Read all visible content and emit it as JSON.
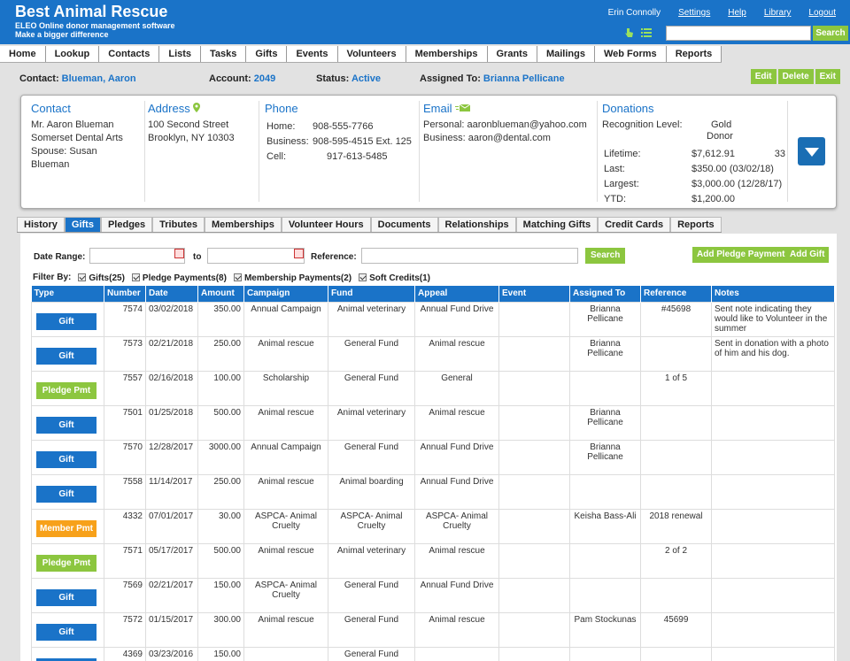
{
  "app": {
    "title": "Best Animal Rescue",
    "tagline1": "ELEO Online donor management software",
    "tagline2": "Make a bigger difference",
    "user": "Erin Connolly",
    "links": [
      "Settings",
      "Help",
      "Library",
      "Logout"
    ],
    "search_label": "Search"
  },
  "nav": [
    "Home",
    "Lookup",
    "Contacts",
    "Lists",
    "Tasks",
    "Gifts",
    "Events",
    "Volunteers",
    "Memberships",
    "Grants",
    "Mailings",
    "Web Forms",
    "Reports"
  ],
  "contact": {
    "contact_label": "Contact:",
    "contact": "Blueman, Aaron",
    "account_label": "Account:",
    "account": "2049",
    "status_label": "Status:",
    "status": "Active",
    "assigned_label": "Assigned To:",
    "assigned": "Brianna Pellicane",
    "buttons": [
      "Edit",
      "Delete",
      "Exit"
    ]
  },
  "card": {
    "contact_title": "Contact",
    "contact_lines": [
      "Mr. Aaron Blueman",
      "Somerset Dental Arts",
      "Spouse: Susan",
      "Blueman"
    ],
    "address_title": "Address",
    "address_lines": [
      "100 Second Street",
      "Brooklyn, NY 10303"
    ],
    "phone_title": "Phone",
    "phone_rows": [
      [
        "Home:",
        "908-555-7766"
      ],
      [
        "Business:",
        "908-595-4515 Ext. 125"
      ],
      [
        "Cell:",
        "917-613-5485"
      ]
    ],
    "email_title": "Email",
    "email_lines": [
      "Personal: aaronblueman@yahoo.com",
      "Business: aaron@dental.com"
    ],
    "donations_title": "Donations",
    "recog_label": "Recognition Level:",
    "recog_value1": "Gold",
    "recog_value2": "Donor",
    "don_rows": [
      [
        "Lifetime:",
        "$7,612.91",
        "33"
      ],
      [
        "Last:",
        "$350.00 (03/02/18)",
        ""
      ],
      [
        "Largest:",
        "$3,000.00 (12/28/17)",
        ""
      ],
      [
        "YTD:",
        "$1,200.00",
        ""
      ]
    ]
  },
  "tabs": [
    "History",
    "Gifts",
    "Pledges",
    "Tributes",
    "Memberships",
    "Volunteer Hours",
    "Documents",
    "Relationships",
    "Matching Gifts",
    "Credit Cards",
    "Reports"
  ],
  "filters": {
    "date_range": "Date Range:",
    "to": "to",
    "reference": "Reference:",
    "search": "Search",
    "add_pledge": "Add Pledge Payment",
    "add_gift": "Add Gift",
    "filter_by": "Filter By:",
    "checks": [
      "Gifts(25)",
      "Pledge Payments(8)",
      "Membership Payments(2)",
      "Soft Credits(1)"
    ]
  },
  "table": {
    "headers": [
      "Type",
      "Number",
      "Date",
      "Amount",
      "Campaign",
      "Fund",
      "Appeal",
      "Event",
      "Assigned To",
      "Reference",
      "Notes"
    ],
    "rows": [
      [
        "Gift",
        "7574",
        "03/02/2018",
        "350.00",
        "Annual Campaign",
        "Animal veterinary",
        "Annual Fund Drive",
        "",
        "Brianna Pellicane",
        "#45698",
        "Sent note indicating they would like to Volunteer in the summer"
      ],
      [
        "Gift",
        "7573",
        "02/21/2018",
        "250.00",
        "Animal rescue",
        "General Fund",
        "Animal rescue",
        "",
        "Brianna Pellicane",
        "",
        "Sent in donation with a photo of him and his dog."
      ],
      [
        "Pledge Pmt",
        "7557",
        "02/16/2018",
        "100.00",
        "Scholarship",
        "General Fund",
        "General",
        "",
        "",
        "1 of 5",
        ""
      ],
      [
        "Gift",
        "7501",
        "01/25/2018",
        "500.00",
        "Animal rescue",
        "Animal veterinary",
        "Animal rescue",
        "",
        "Brianna Pellicane",
        "",
        ""
      ],
      [
        "Gift",
        "7570",
        "12/28/2017",
        "3000.00",
        "Annual Campaign",
        "General Fund",
        "Annual Fund Drive",
        "",
        "Brianna Pellicane",
        "",
        ""
      ],
      [
        "Gift",
        "7558",
        "11/14/2017",
        "250.00",
        "Animal rescue",
        "Animal boarding",
        "Annual Fund Drive",
        "",
        "",
        "",
        ""
      ],
      [
        "Member Pmt",
        "4332",
        "07/01/2017",
        "30.00",
        "ASPCA- Animal Cruelty",
        "ASPCA- Animal Cruelty",
        "ASPCA- Animal Cruelty",
        "",
        "Keisha Bass-Ali",
        "2018 renewal",
        ""
      ],
      [
        "Pledge Pmt",
        "7571",
        "05/17/2017",
        "500.00",
        "Animal rescue",
        "Animal veterinary",
        "Animal rescue",
        "",
        "",
        "2 of 2",
        ""
      ],
      [
        "Gift",
        "7569",
        "02/21/2017",
        "150.00",
        "ASPCA- Animal Cruelty",
        "General Fund",
        "Annual Fund Drive",
        "",
        "",
        "",
        ""
      ],
      [
        "Gift",
        "7572",
        "01/15/2017",
        "300.00",
        "Animal rescue",
        "General Fund",
        "Animal rescue",
        "",
        "Pam Stockunas",
        "45699",
        ""
      ],
      [
        "Gift",
        "4369",
        "03/23/2016",
        "150.00",
        "",
        "General Fund",
        "",
        "",
        "",
        "",
        ""
      ]
    ]
  },
  "colors": {
    "primary": "#1a73c8",
    "green": "#8cc63f",
    "orange": "#f7a11a"
  }
}
